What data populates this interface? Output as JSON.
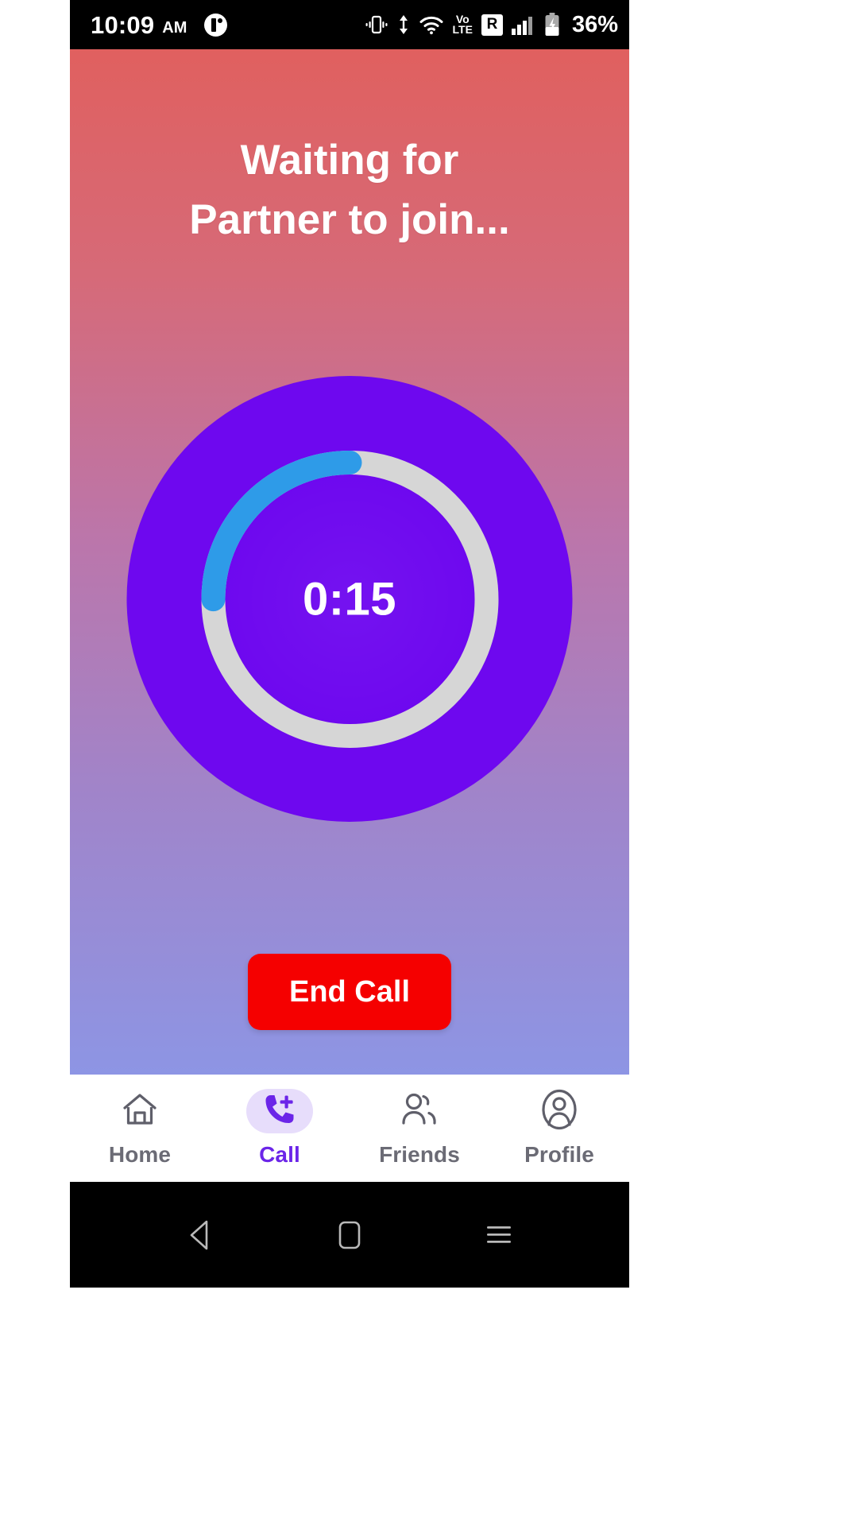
{
  "status_bar": {
    "time": "10:09",
    "ampm": "AM",
    "app_icon": "notification-app-icon",
    "icons": [
      "vibrate-icon",
      "data-transfer-icon",
      "wifi-icon",
      "volte-icon",
      "roaming-icon",
      "cellular-signal-icon",
      "battery-charging-icon"
    ],
    "volte_top": "Vo",
    "volte_bottom": "LTE",
    "roaming_label": "R",
    "battery_percent": "36%"
  },
  "screen": {
    "title_line1": "Waiting for",
    "title_line2": "Partner to join...",
    "timer": "0:15",
    "progress_percent": 25,
    "end_call_label": "End Call"
  },
  "colors": {
    "gradient_top": "#E0605F",
    "gradient_bottom": "#8D95E4",
    "disc_purple": "#6E08EF",
    "ring_track": "#D6D6D6",
    "ring_progress": "#2E9BE8",
    "end_call_red": "#F50000",
    "accent_purple": "#6B25E8",
    "active_pill": "#E7DDFB",
    "inactive_tab": "#6B6B75"
  },
  "tabs": [
    {
      "label": "Home",
      "icon": "home-icon",
      "active": false
    },
    {
      "label": "Call",
      "icon": "phone-plus-icon",
      "active": true
    },
    {
      "label": "Friends",
      "icon": "people-icon",
      "active": false
    },
    {
      "label": "Profile",
      "icon": "profile-icon",
      "active": false
    }
  ],
  "android_nav": {
    "back": "back-triangle-icon",
    "home": "home-square-icon",
    "recents": "recents-menu-icon"
  }
}
